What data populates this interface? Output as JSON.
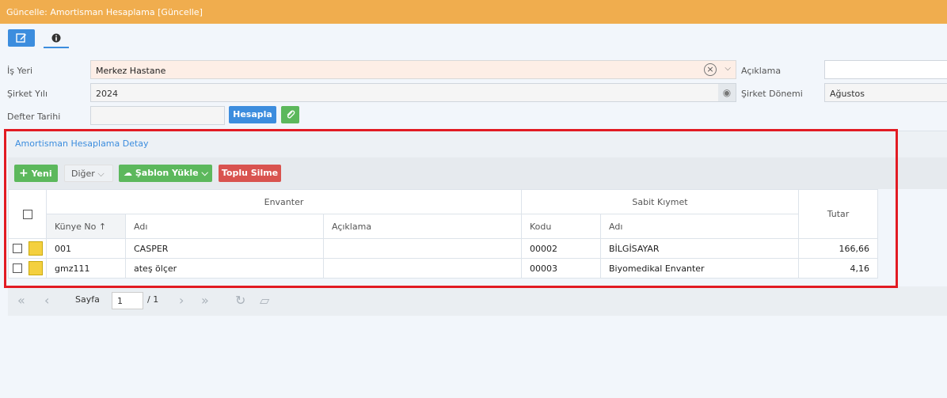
{
  "title": "Güncelle: Amortisman Hesaplama [Güncelle]",
  "toolbar": {
    "edit_icon": "pencil-square-icon",
    "info_icon": "info-icon"
  },
  "form": {
    "is_yeri_label": "İş Yeri",
    "is_yeri_value": "Merkez Hastane",
    "sirket_yili_label": "Şirket Yılı",
    "sirket_yili_value": "2024",
    "defter_tarihi_label": "Defter Tarihi",
    "defter_tarihi_value": "",
    "aciklama_label": "Açıklama",
    "aciklama_value": "",
    "sirket_donemi_label": "Şirket Dönemi",
    "sirket_donemi_value": "Ağustos",
    "hesapla_label": "Hesapla"
  },
  "panel": {
    "title": "Amortisman Hesaplama Detay",
    "yeni_label": "Yeni",
    "diger_label": "Diğer",
    "sablon_label": "Şablon Yükle",
    "toplu_label": "Toplu Silme"
  },
  "grid": {
    "group_envanter": "Envanter",
    "group_sabit": "Sabit Kıymet",
    "col_kunye": "Künye No",
    "col_adi": "Adı",
    "col_aciklama": "Açıklama",
    "col_kodu": "Kodu",
    "col_sabit_adi": "Adı",
    "col_tutar": "Tutar",
    "rows": [
      {
        "kunye": "001",
        "adi": "CASPER",
        "aciklama": "",
        "kodu": "00002",
        "sabit_adi": "BİLGİSAYAR",
        "tutar": "166,66"
      },
      {
        "kunye": "gmz111",
        "adi": "ateş ölçer",
        "aciklama": "",
        "kodu": "00003",
        "sabit_adi": "Biyomedikal Envanter",
        "tutar": "4,16"
      }
    ]
  },
  "pager": {
    "sayfa_label": "Sayfa",
    "page_value": "1",
    "total": "/ 1"
  }
}
